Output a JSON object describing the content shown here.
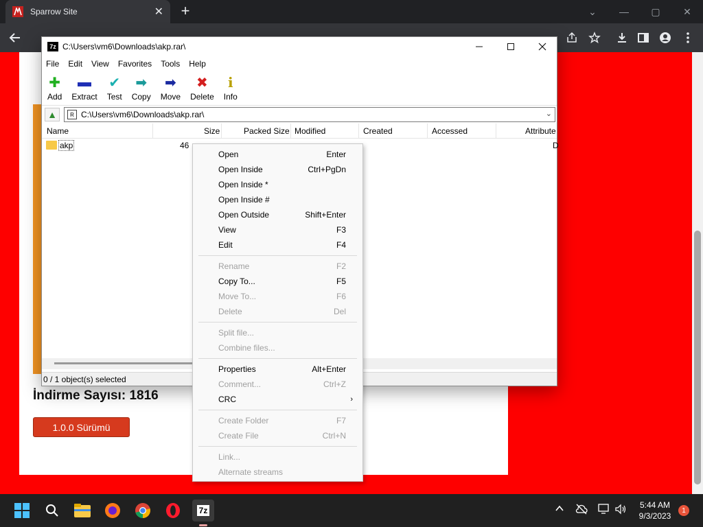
{
  "browser": {
    "tab_title": "Sparrow Site",
    "tab_close": "✕",
    "new_tab": "+",
    "url": "",
    "window_controls": {
      "minimize": "—",
      "maximize": "▢",
      "close": "✕",
      "chevron": "⌄"
    }
  },
  "page": {
    "download_count": "İndirme Sayısı: 1816",
    "version_button": "1.0.0 Sürümü"
  },
  "sevenzip": {
    "title": "C:\\Users\\vm6\\Downloads\\akp.rar\\",
    "logo": "7z",
    "menu": [
      "File",
      "Edit",
      "View",
      "Favorites",
      "Tools",
      "Help"
    ],
    "tools": [
      {
        "label": "Add",
        "icon": "add-icon",
        "glyph": "✚",
        "color": "#20b020"
      },
      {
        "label": "Extract",
        "icon": "extract-icon",
        "glyph": "▬",
        "color": "#1f2fb5"
      },
      {
        "label": "Test",
        "icon": "test-icon",
        "glyph": "✔",
        "color": "#1ab0b0"
      },
      {
        "label": "Copy",
        "icon": "copy-icon",
        "glyph": "➡",
        "color": "#1a9a9a"
      },
      {
        "label": "Move",
        "icon": "move-icon",
        "glyph": "➡",
        "color": "#1a2aa0"
      },
      {
        "label": "Delete",
        "icon": "delete-icon",
        "glyph": "✖",
        "color": "#d42020"
      },
      {
        "label": "Info",
        "icon": "info-icon",
        "glyph": "i",
        "color": "#b8a000"
      }
    ],
    "address": "C:\\Users\\vm6\\Downloads\\akp.rar\\",
    "columns": [
      "Name",
      "Size",
      "Packed Size",
      "Modified",
      "Created",
      "Accessed",
      "Attribute"
    ],
    "rows": [
      {
        "name": "akp",
        "size": "46",
        "attr": "D"
      }
    ],
    "status": "0 / 1 object(s) selected"
  },
  "context_menu": {
    "groups": [
      [
        {
          "label": "Open",
          "shortcut": "Enter",
          "enabled": true
        },
        {
          "label": "Open Inside",
          "shortcut": "Ctrl+PgDn",
          "enabled": true
        },
        {
          "label": "Open Inside *",
          "shortcut": "",
          "enabled": true
        },
        {
          "label": "Open Inside #",
          "shortcut": "",
          "enabled": true
        },
        {
          "label": "Open Outside",
          "shortcut": "Shift+Enter",
          "enabled": true
        },
        {
          "label": "View",
          "shortcut": "F3",
          "enabled": true
        },
        {
          "label": "Edit",
          "shortcut": "F4",
          "enabled": true
        }
      ],
      [
        {
          "label": "Rename",
          "shortcut": "F2",
          "enabled": false
        },
        {
          "label": "Copy To...",
          "shortcut": "F5",
          "enabled": true
        },
        {
          "label": "Move To...",
          "shortcut": "F6",
          "enabled": false
        },
        {
          "label": "Delete",
          "shortcut": "Del",
          "enabled": false
        }
      ],
      [
        {
          "label": "Split file...",
          "shortcut": "",
          "enabled": false
        },
        {
          "label": "Combine files...",
          "shortcut": "",
          "enabled": false
        }
      ],
      [
        {
          "label": "Properties",
          "shortcut": "Alt+Enter",
          "enabled": true
        },
        {
          "label": "Comment...",
          "shortcut": "Ctrl+Z",
          "enabled": false
        },
        {
          "label": "CRC",
          "shortcut": "",
          "enabled": true,
          "submenu": true
        }
      ],
      [
        {
          "label": "Create Folder",
          "shortcut": "F7",
          "enabled": false
        },
        {
          "label": "Create File",
          "shortcut": "Ctrl+N",
          "enabled": false
        }
      ],
      [
        {
          "label": "Link...",
          "shortcut": "",
          "enabled": false
        },
        {
          "label": "Alternate streams",
          "shortcut": "",
          "enabled": false
        }
      ]
    ]
  },
  "taskbar": {
    "time": "5:44 AM",
    "date": "9/3/2023",
    "notifications": "1",
    "sevenzip_label": "7z"
  }
}
